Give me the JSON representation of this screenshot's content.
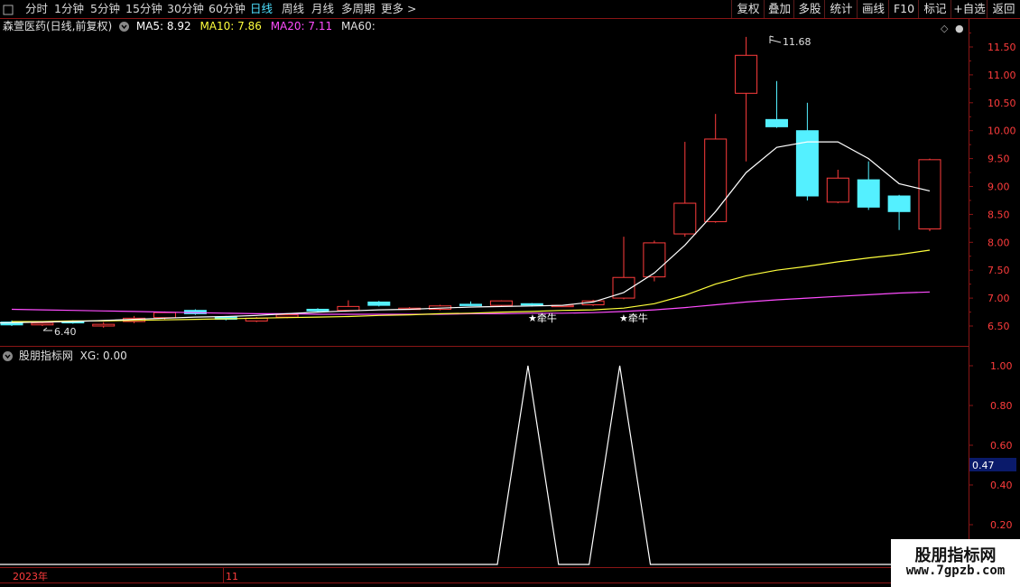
{
  "toolbar": {
    "left_items": [
      "分时",
      "1分钟",
      "5分钟",
      "15分钟",
      "30分钟",
      "60分钟",
      "日线",
      "周线",
      "月线",
      "多周期",
      "更多 >"
    ],
    "active": "日线",
    "right_items": [
      "复权",
      "叠加",
      "多股",
      "统计",
      "画线",
      "F10",
      "标记",
      "+自选",
      "返回"
    ]
  },
  "main_header": {
    "stock": "森萱医药(日线,前复权)",
    "ma5": "MA5: 8.92",
    "ma10": "MA10: 7.86",
    "ma20": "MA20: 7.11",
    "ma60": "MA60:"
  },
  "sub_header": {
    "name": "股朋指标网",
    "xg": "XG: 0.00"
  },
  "price_axis": [
    "11.50",
    "11.00",
    "10.50",
    "10.00",
    "9.50",
    "9.00",
    "8.50",
    "8.00",
    "7.50",
    "7.00",
    "6.50"
  ],
  "ind_axis": [
    "1.00",
    "0.80",
    "0.60",
    "0.40",
    "0.20"
  ],
  "ind_current": "0.47",
  "annotations": {
    "high": "11.68",
    "low": "6.40",
    "signal1": "★牵牛",
    "signal2": "★牵牛"
  },
  "time_labels": [
    "2023年",
    "11"
  ],
  "watermark": {
    "title": "股朋指标网",
    "url": "www.7gpzb.com"
  },
  "colors": {
    "up": "#ff3c3c",
    "down": "#54f0ff",
    "ma5": "#ffffff",
    "ma10": "#ffff3c",
    "ma20": "#ff4cff",
    "border": "#8a1515"
  },
  "chart_data": {
    "type": "candlestick",
    "ylim": [
      6.2,
      12.0
    ],
    "candles": [
      {
        "o": 6.57,
        "c": 6.52,
        "h": 6.6,
        "l": 6.5
      },
      {
        "o": 6.52,
        "c": 6.55,
        "h": 6.58,
        "l": 6.5
      },
      {
        "o": 6.58,
        "c": 6.56,
        "h": 6.6,
        "l": 6.54
      },
      {
        "o": 6.5,
        "c": 6.53,
        "h": 6.57,
        "l": 6.47
      },
      {
        "o": 6.58,
        "c": 6.64,
        "h": 6.68,
        "l": 6.55
      },
      {
        "o": 6.65,
        "c": 6.74,
        "h": 6.76,
        "l": 6.62
      },
      {
        "o": 6.78,
        "c": 6.72,
        "h": 6.8,
        "l": 6.7
      },
      {
        "o": 6.66,
        "c": 6.62,
        "h": 6.68,
        "l": 6.6
      },
      {
        "o": 6.59,
        "c": 6.64,
        "h": 6.66,
        "l": 6.57
      },
      {
        "o": 6.66,
        "c": 6.7,
        "h": 6.72,
        "l": 6.64
      },
      {
        "o": 6.8,
        "c": 6.77,
        "h": 6.82,
        "l": 6.75
      },
      {
        "o": 6.78,
        "c": 6.85,
        "h": 6.96,
        "l": 6.76
      },
      {
        "o": 6.93,
        "c": 6.87,
        "h": 6.95,
        "l": 6.85
      },
      {
        "o": 6.82,
        "c": 6.82,
        "h": 6.84,
        "l": 6.8
      },
      {
        "o": 6.8,
        "c": 6.86,
        "h": 6.88,
        "l": 6.78
      },
      {
        "o": 6.89,
        "c": 6.87,
        "h": 6.94,
        "l": 6.86
      },
      {
        "o": 6.87,
        "c": 6.95,
        "h": 6.96,
        "l": 6.85
      },
      {
        "o": 6.9,
        "c": 6.88,
        "h": 6.91,
        "l": 6.85
      },
      {
        "o": 6.87,
        "c": 6.87,
        "h": 6.88,
        "l": 6.85
      },
      {
        "o": 6.88,
        "c": 6.95,
        "h": 6.97,
        "l": 6.86
      },
      {
        "o": 7.0,
        "c": 7.37,
        "h": 8.1,
        "l": 6.98
      },
      {
        "o": 7.38,
        "c": 7.99,
        "h": 8.03,
        "l": 7.3
      },
      {
        "o": 8.15,
        "c": 8.7,
        "h": 9.8,
        "l": 8.1
      },
      {
        "o": 8.37,
        "c": 9.85,
        "h": 10.3,
        "l": 8.35
      },
      {
        "o": 10.67,
        "c": 11.35,
        "h": 11.68,
        "l": 9.45
      },
      {
        "o": 10.2,
        "c": 10.07,
        "h": 10.89,
        "l": 10.05
      },
      {
        "o": 10.0,
        "c": 8.83,
        "h": 10.5,
        "l": 8.75
      },
      {
        "o": 8.72,
        "c": 9.15,
        "h": 9.3,
        "l": 8.7
      },
      {
        "o": 9.12,
        "c": 8.63,
        "h": 9.45,
        "l": 8.58
      },
      {
        "o": 8.83,
        "c": 8.55,
        "h": 8.85,
        "l": 8.22
      },
      {
        "o": 8.24,
        "c": 9.48,
        "h": 9.5,
        "l": 8.2
      }
    ],
    "ma5": [
      6.55,
      6.56,
      6.57,
      6.58,
      6.6,
      6.62,
      6.64,
      6.66,
      6.67,
      6.69,
      6.72,
      6.75,
      6.77,
      6.79,
      6.8,
      6.82,
      6.84,
      6.85,
      6.86,
      6.87,
      6.93,
      7.1,
      7.45,
      7.95,
      8.55,
      9.25,
      9.7,
      9.8,
      9.8,
      9.5,
      9.05,
      8.92
    ],
    "ma10": [
      6.58,
      6.58,
      6.59,
      6.59,
      6.6,
      6.61,
      6.62,
      6.63,
      6.64,
      6.65,
      6.66,
      6.67,
      6.69,
      6.7,
      6.72,
      6.73,
      6.75,
      6.76,
      6.78,
      6.79,
      6.82,
      6.9,
      7.05,
      7.25,
      7.4,
      7.5,
      7.57,
      7.65,
      7.72,
      7.78,
      7.86
    ],
    "ma20": [
      6.8,
      6.79,
      6.78,
      6.77,
      6.76,
      6.75,
      6.74,
      6.73,
      6.72,
      6.72,
      6.71,
      6.71,
      6.71,
      6.71,
      6.71,
      6.72,
      6.72,
      6.73,
      6.73,
      6.74,
      6.76,
      6.79,
      6.83,
      6.88,
      6.93,
      6.97,
      7.0,
      7.03,
      7.06,
      7.09,
      7.11
    ],
    "xg": [
      0,
      0,
      0,
      0,
      0,
      0,
      0,
      0,
      0,
      0,
      0,
      0,
      0,
      0,
      0,
      0,
      0,
      1,
      0,
      0,
      1,
      0,
      0,
      0,
      0,
      0,
      0,
      0,
      0,
      0,
      0
    ]
  }
}
